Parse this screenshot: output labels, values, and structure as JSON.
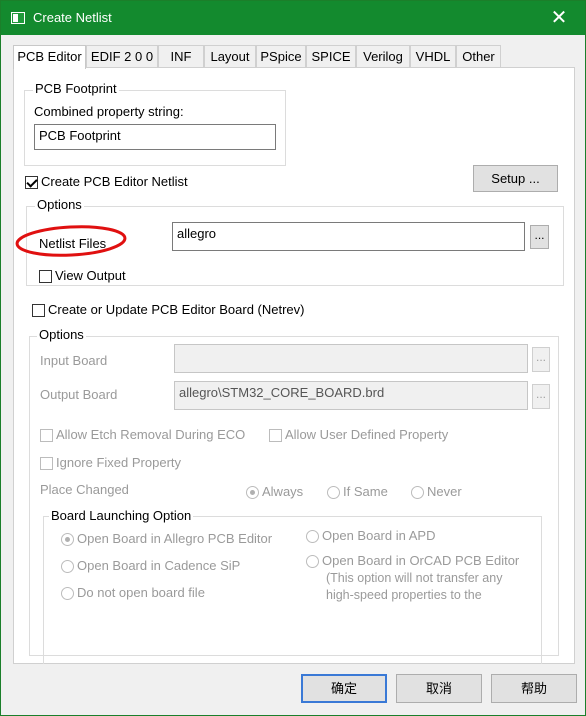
{
  "window": {
    "title": "Create Netlist"
  },
  "tabs": [
    {
      "label": "PCB Editor",
      "active": true
    },
    {
      "label": "EDIF 2 0 0"
    },
    {
      "label": "INF"
    },
    {
      "label": "Layout"
    },
    {
      "label": "PSpice"
    },
    {
      "label": "SPICE"
    },
    {
      "label": "Verilog"
    },
    {
      "label": "VHDL"
    },
    {
      "label": "Other"
    }
  ],
  "pcb_footprint": {
    "group_title": "PCB Footprint",
    "label": "Combined property string:",
    "value": "PCB Footprint"
  },
  "create_netlist": {
    "label": "Create PCB Editor Netlist",
    "checked": true
  },
  "setup_button": "Setup ...",
  "options1": {
    "group_title": "Options",
    "netlist_files_label": "Netlist Files",
    "netlist_files_value": "allegro",
    "browse": "...",
    "view_output_label": "View Output",
    "view_output_checked": false
  },
  "create_board": {
    "label": "Create or Update PCB Editor Board (Netrev)",
    "checked": false
  },
  "options2": {
    "group_title": "Options",
    "input_board_label": "Input Board",
    "input_board_value": "",
    "output_board_label": "Output Board",
    "output_board_value": "allegro\\STM32_CORE_BOARD.brd",
    "browse": "...",
    "allow_etch_label": "Allow Etch Removal During ECO",
    "allow_user_defined_label": "Allow User Defined Property",
    "ignore_fixed_label": "Ignore Fixed Property",
    "place_changed_label": "Place Changed",
    "place_changed_options": [
      "Always",
      "If Same",
      "Never"
    ],
    "place_changed_selected": "Always"
  },
  "board_launch": {
    "group_title": "Board Launching Option",
    "options": [
      "Open Board in Allegro PCB Editor",
      "Open Board in Cadence SiP",
      "Do not open board file",
      "Open Board in APD",
      "Open Board in OrCAD PCB Editor"
    ],
    "selected": "Open Board in Allegro PCB Editor",
    "note_line1": "(This option will not transfer any",
    "note_line2": "high-speed properties to the"
  },
  "buttons": {
    "ok": "确定",
    "cancel": "取消",
    "help": "帮助"
  },
  "colors": {
    "titlebar": "#138a2e",
    "annotation_circle": "#e01010",
    "default_button_border": "#3a79d6"
  },
  "icons": {
    "close": "close-icon",
    "app": "window-app-icon"
  }
}
